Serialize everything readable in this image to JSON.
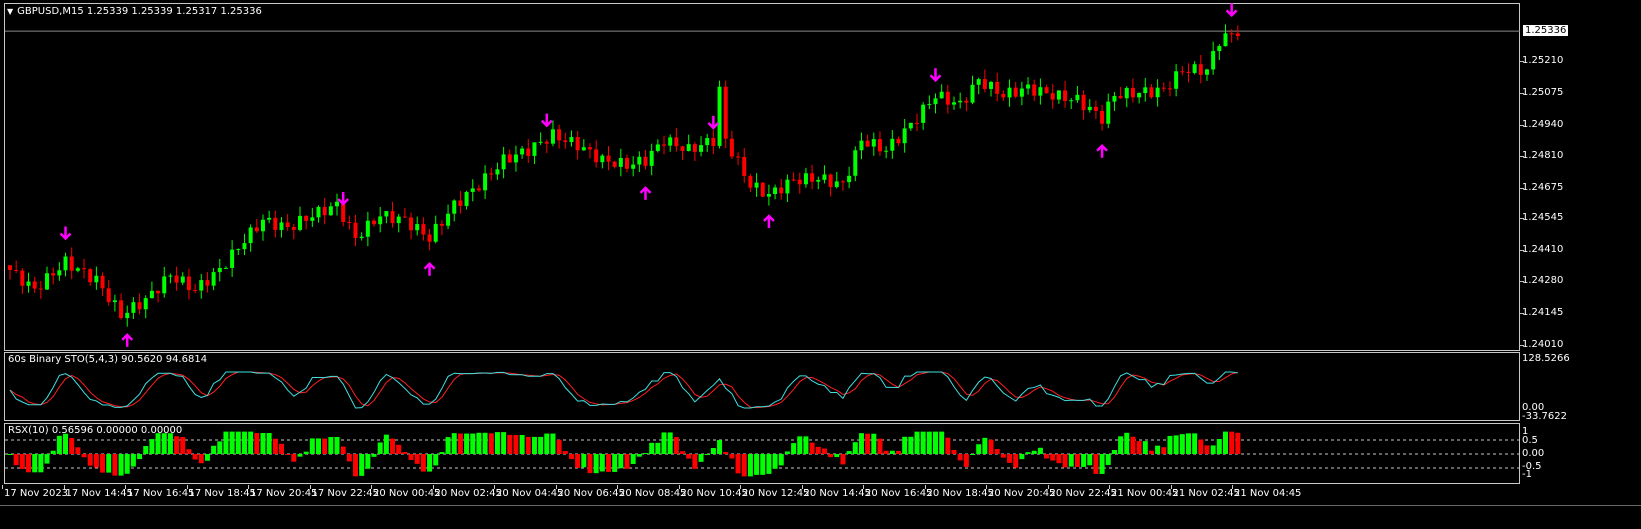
{
  "header": {
    "symbol_line": "GBPUSD,M15  1.25339 1.25339 1.25317 1.25336",
    "menu_icon": "triangle-down-icon"
  },
  "price_axis": {
    "current_price": "1.25336",
    "ticks": [
      "1.25210",
      "1.25075",
      "1.24940",
      "1.24810",
      "1.24675",
      "1.24545",
      "1.24410",
      "1.24280",
      "1.24145",
      "1.24010"
    ]
  },
  "sto_panel": {
    "label": "60s Binary STO(5,4,3) 90.5620 94.6814",
    "axis_top": "128.5266",
    "axis_zero": "0.00",
    "axis_bottom": "-33.7622"
  },
  "rsx_panel": {
    "label": "RSX(10) 0.56596 0.00000 0.00000",
    "axis": [
      "1",
      "0.5",
      "0.00",
      "-0.5",
      "-1"
    ]
  },
  "time_axis": [
    "17 Nov 2023",
    "17 Nov 14:45",
    "17 Nov 16:45",
    "17 Nov 18:45",
    "17 Nov 20:45",
    "17 Nov 22:45",
    "20 Nov 00:45",
    "20 Nov 02:45",
    "20 Nov 04:45",
    "20 Nov 06:45",
    "20 Nov 08:45",
    "20 Nov 10:45",
    "20 Nov 12:45",
    "20 Nov 14:45",
    "20 Nov 16:45",
    "20 Nov 18:45",
    "20 Nov 20:45",
    "20 Nov 22:45",
    "21 Nov 00:45",
    "21 Nov 02:45",
    "21 Nov 04:45"
  ],
  "colors": {
    "bull": "#00ff00",
    "bear": "#ff0000",
    "arrow": "#ff00ff",
    "sto_main": "#40e0e0",
    "sto_signal": "#ff2020",
    "grid": "#c8c8c8"
  },
  "chart_data": {
    "type": "candlestick",
    "close_anchors": [
      [
        0,
        1.24327
      ],
      [
        4,
        1.24243
      ],
      [
        9,
        1.2436
      ],
      [
        14,
        1.24285
      ],
      [
        18,
        1.24137
      ],
      [
        22,
        1.242
      ],
      [
        26,
        1.24306
      ],
      [
        30,
        1.24243
      ],
      [
        34,
        1.24327
      ],
      [
        38,
        1.24454
      ],
      [
        41,
        1.24538
      ],
      [
        45,
        1.24504
      ],
      [
        49,
        1.24559
      ],
      [
        53,
        1.24601
      ],
      [
        56,
        1.24462
      ],
      [
        60,
        1.24559
      ],
      [
        64,
        1.24538
      ],
      [
        68,
        1.24462
      ],
      [
        72,
        1.24601
      ],
      [
        76,
        1.24686
      ],
      [
        80,
        1.24791
      ],
      [
        84,
        1.24834
      ],
      [
        88,
        1.24897
      ],
      [
        92,
        1.24855
      ],
      [
        96,
        1.24791
      ],
      [
        100,
        1.2477
      ],
      [
        103,
        1.24791
      ],
      [
        106,
        1.24876
      ],
      [
        110,
        1.24834
      ],
      [
        114,
        1.24876
      ],
      [
        115,
        1.25087
      ],
      [
        116,
        1.24876
      ],
      [
        120,
        1.24686
      ],
      [
        123,
        1.24644
      ],
      [
        127,
        1.24707
      ],
      [
        131,
        1.24715
      ],
      [
        135,
        1.24686
      ],
      [
        138,
        1.24876
      ],
      [
        142,
        1.24834
      ],
      [
        146,
        1.2494
      ],
      [
        150,
        1.25066
      ],
      [
        154,
        1.25024
      ],
      [
        157,
        1.25129
      ],
      [
        161,
        1.25066
      ],
      [
        165,
        1.25096
      ],
      [
        169,
        1.25066
      ],
      [
        173,
        1.25045
      ],
      [
        177,
        1.24969
      ],
      [
        179,
        1.25066
      ],
      [
        184,
        1.25079
      ],
      [
        187,
        1.25087
      ],
      [
        190,
        1.25172
      ],
      [
        194,
        1.25172
      ],
      [
        196,
        1.25298
      ],
      [
        199,
        1.25336
      ]
    ],
    "signals_down": [
      9,
      54,
      87,
      114,
      150,
      198
    ],
    "signals_up": [
      19,
      68,
      103,
      123,
      177
    ],
    "price_range": [
      1.2401,
      1.2545
    ]
  }
}
